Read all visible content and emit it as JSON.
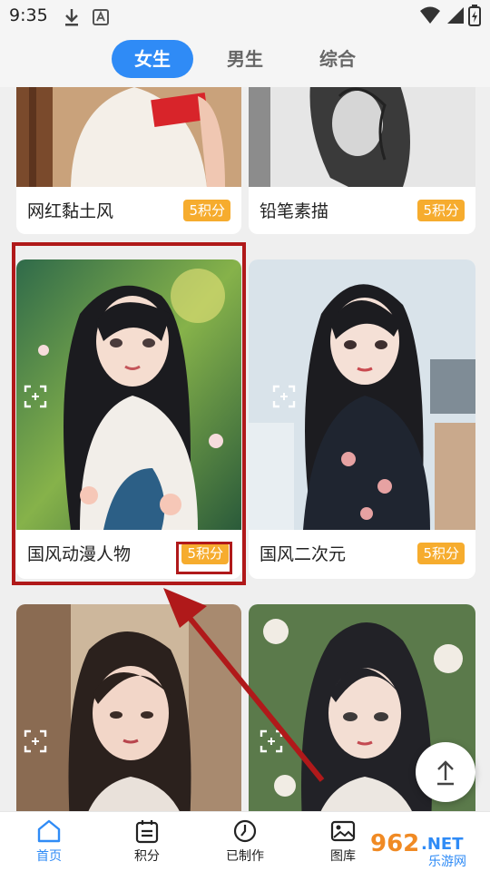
{
  "status_bar": {
    "time": "9:35"
  },
  "tabs": [
    {
      "label": "女生",
      "active": true
    },
    {
      "label": "男生",
      "active": false
    },
    {
      "label": "综合",
      "active": false
    }
  ],
  "cards": [
    {
      "title": "网红黏土风",
      "badge": "5积分"
    },
    {
      "title": "铅笔素描",
      "badge": "5积分"
    },
    {
      "title": "国风动漫人物",
      "badge": "5积分"
    },
    {
      "title": "国风二次元",
      "badge": "5积分"
    }
  ],
  "bottom_nav": [
    {
      "label": "首页",
      "icon": "home-icon",
      "active": true
    },
    {
      "label": "积分",
      "icon": "points-icon",
      "active": false
    },
    {
      "label": "已制作",
      "icon": "clock-icon",
      "active": false
    },
    {
      "label": "图库",
      "icon": "gallery-icon",
      "active": false
    }
  ],
  "watermark": {
    "brand": "962",
    "suffix": ".NET",
    "sub": "乐游网"
  },
  "colors": {
    "accent": "#2f8bf6",
    "badge": "#f6ac2e",
    "highlight": "#b0191a"
  }
}
